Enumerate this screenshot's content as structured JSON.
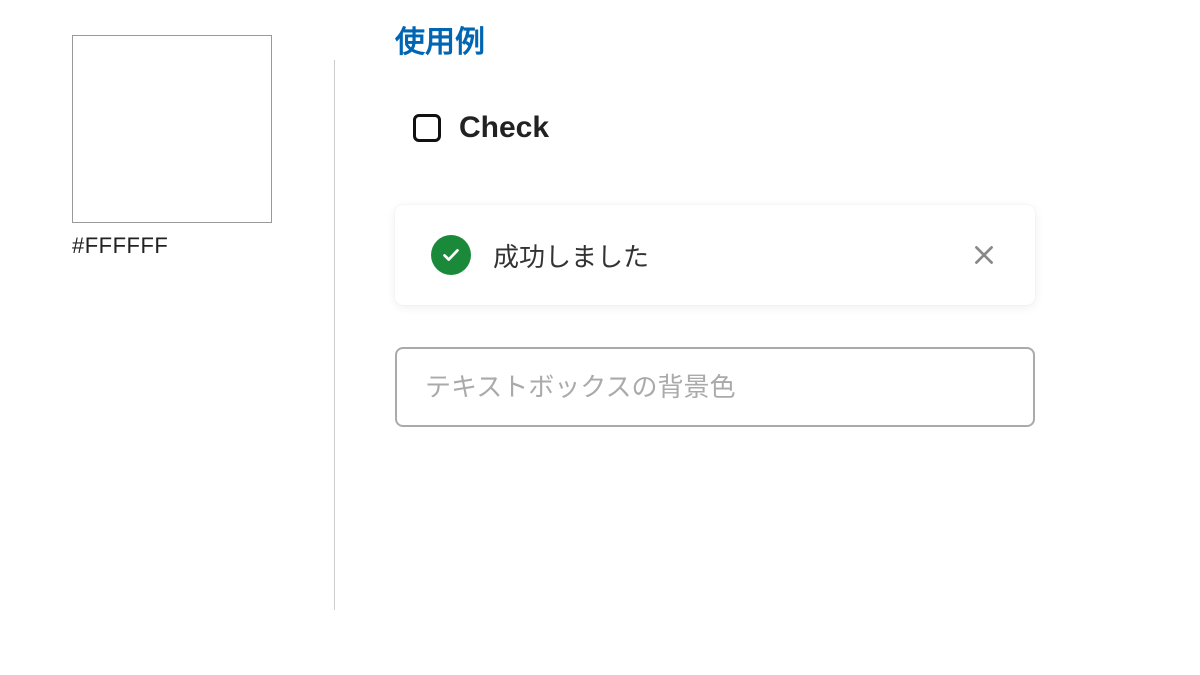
{
  "sidebar": {
    "swatch_color": "#FFFFFF",
    "swatch_label": "#FFFFFF"
  },
  "main": {
    "section_title": "使用例",
    "checkbox": {
      "label": "Check",
      "checked": false
    },
    "alert": {
      "message": "成功しました",
      "type": "success",
      "accent_color": "#1a8a3a"
    },
    "textbox": {
      "value": "",
      "placeholder": "テキストボックスの背景色"
    }
  }
}
